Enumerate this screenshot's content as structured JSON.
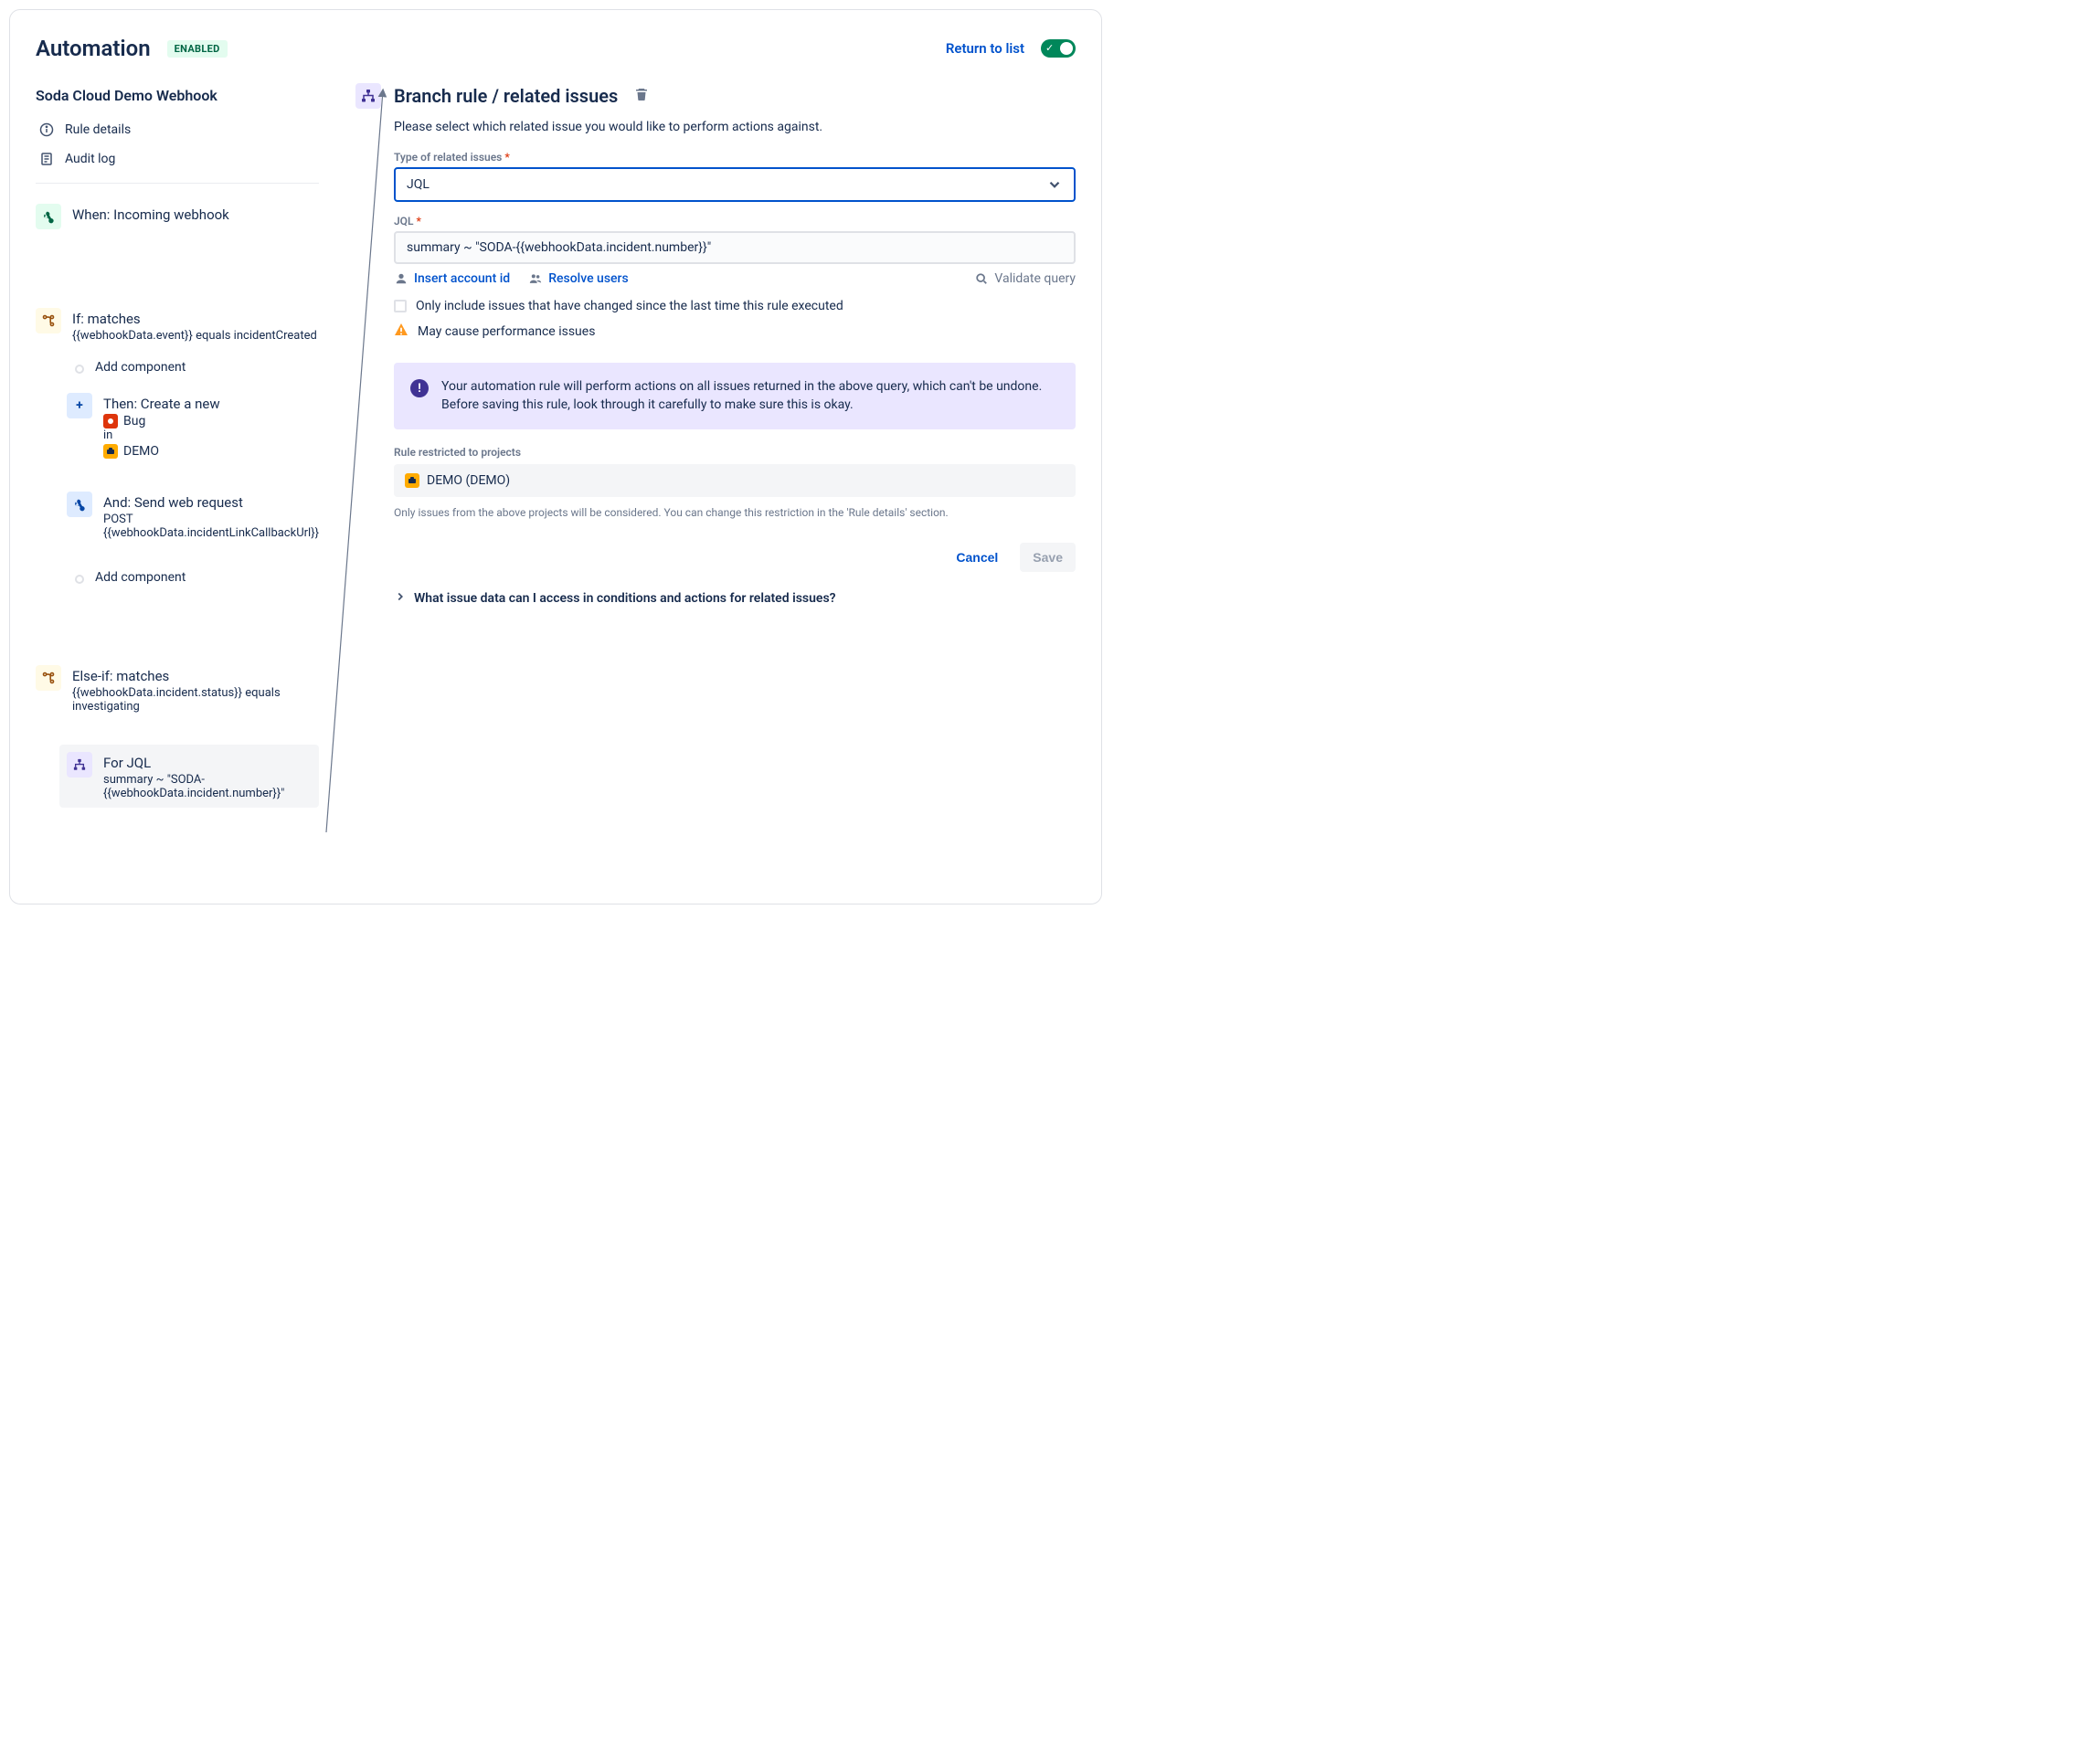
{
  "header": {
    "title": "Automation",
    "badge": "ENABLED",
    "return_link": "Return to list"
  },
  "sidebar": {
    "webhook_name": "Soda Cloud Demo Webhook",
    "rule_details": "Rule details",
    "audit_log": "Audit log",
    "when": {
      "title": "When: Incoming webhook"
    },
    "if": {
      "title": "If: matches",
      "sub": "{{webhookData.event}} equals incidentCreated"
    },
    "add_component": "Add component",
    "then": {
      "title": "Then: Create a new",
      "bug": "Bug",
      "in": "in",
      "project": "DEMO"
    },
    "and": {
      "title": "And: Send web request",
      "method": "POST",
      "url": "{{webhookData.incidentLinkCallbackUrl}}"
    },
    "elseif": {
      "title": "Else-if: matches",
      "sub": "{{webhookData.incident.status}} equals investigating"
    },
    "for": {
      "title": "For JQL",
      "sub": "summary ~ \"SODA-{{webhookData.incident.number}}\""
    }
  },
  "main": {
    "title": "Branch rule / related issues",
    "intro": "Please select which related issue you would like to perform actions against.",
    "type_label": "Type of related issues",
    "type_value": "JQL",
    "jql_label": "JQL",
    "jql_value": "summary ~ \"SODA-{{webhookData.incident.number}}\"",
    "insert_account": "Insert account id",
    "resolve_users": "Resolve users",
    "validate_query": "Validate query",
    "only_changed": "Only include issues that have changed since the last time this rule executed",
    "perf_warning": "May cause performance issues",
    "info": "Your automation rule will perform actions on all issues returned in the above query, which can't be undone. Before saving this rule, look through it carefully to make sure this is okay.",
    "restricted_label": "Rule restricted to projects",
    "project_name": "DEMO (DEMO)",
    "restricted_hint": "Only issues from the above projects will be considered. You can change this restriction in the 'Rule details' section.",
    "cancel": "Cancel",
    "save": "Save",
    "expand_help": "What issue data can I access in conditions and actions for related issues?"
  }
}
